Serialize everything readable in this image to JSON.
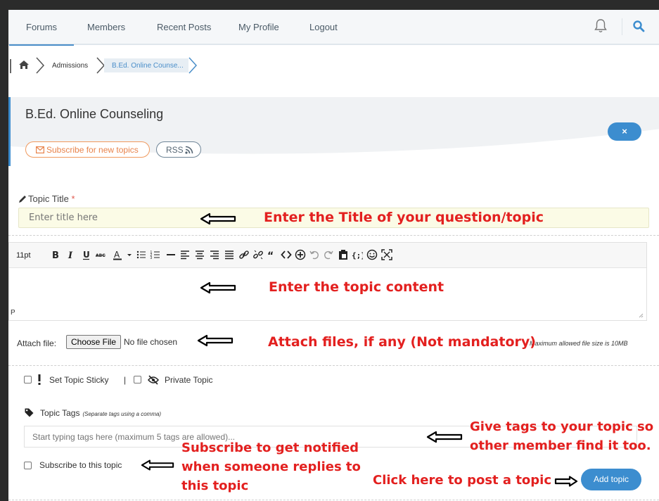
{
  "nav": {
    "items": [
      "Forums",
      "Members",
      "Recent Posts",
      "My Profile",
      "Logout"
    ],
    "active": "Forums"
  },
  "breadcrumb": {
    "items": [
      "Admissions",
      "B.Ed. Online Counse..."
    ]
  },
  "forum": {
    "title": "B.Ed. Online Counseling",
    "subscribe_label": "Subscribe for new topics",
    "rss_label": "RSS",
    "close_label": "×"
  },
  "form": {
    "title_label": "Topic Title",
    "required_mark": "*",
    "title_placeholder": "Enter title here",
    "font_size": "11pt",
    "paragraph_indicator": "P",
    "attach_label": "Attach file:",
    "choose_file": "Choose File",
    "no_file": "No file chosen",
    "max_size": "Maximum allowed file size is 10MB",
    "sticky_label": "Set Topic Sticky",
    "option_sep": "|",
    "private_label": "Private Topic",
    "tags_label": "Topic Tags",
    "tags_hint": "(Separate tags using a comma)",
    "tags_placeholder": "Start typing tags here (maximum 5 tags are allowed)...",
    "subscribe_topic": "Subscribe to this topic",
    "add_button": "Add topic"
  },
  "toolbar_icons": [
    "bold",
    "italic",
    "underline",
    "strikethrough",
    "font-color",
    "bullet-list",
    "numbered-list",
    "horizontal-rule",
    "align-left",
    "align-center",
    "align-right",
    "align-justify",
    "link",
    "unlink",
    "blockquote",
    "code",
    "insert",
    "undo",
    "redo",
    "paste",
    "source-code",
    "emoticon",
    "fullscreen"
  ],
  "annotations": {
    "title": "Enter the Title of your question/topic",
    "content": "Enter the topic content",
    "attach": "Attach files, if any (Not mandatory)",
    "tags_line1": "Give tags to your topic so",
    "tags_line2": "other member find it too.",
    "subscribe_line1": "Subscribe to get notified",
    "subscribe_line2": "when someone replies to",
    "subscribe_line3": "this topic",
    "post": "Click here to post a topic"
  },
  "colors": {
    "accent": "#3c8dcf",
    "annotation": "#e3201f",
    "subscribe_orange": "#e8834b"
  }
}
